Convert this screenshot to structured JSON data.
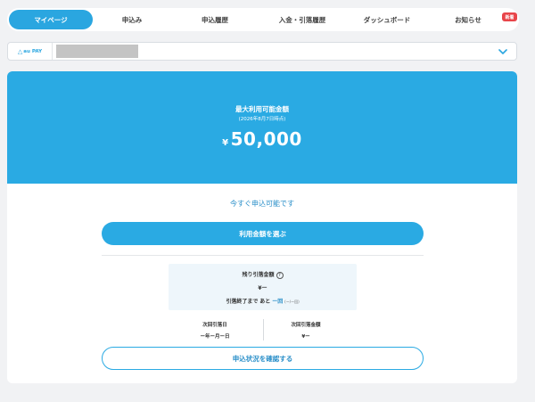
{
  "nav": {
    "items": [
      {
        "label": "マイページ",
        "active": true
      },
      {
        "label": "申込み"
      },
      {
        "label": "申込履歴"
      },
      {
        "label": "入金・引落履歴"
      },
      {
        "label": "ダッシュボード"
      },
      {
        "label": "お知らせ"
      }
    ],
    "badge": "新着"
  },
  "account": {
    "brand": "au PAY",
    "icon": "triangle-logo-icon"
  },
  "hero": {
    "title": "最大利用可能金額",
    "date": "(2026年8月7日時点)",
    "currency": "¥",
    "amount": "50,000"
  },
  "main": {
    "available_text": "今すぐ申込可能です",
    "primary_button": "利用金額を選ぶ",
    "remaining": {
      "label": "残り引落金額",
      "help": "?",
      "value": "¥ー",
      "until_prefix": "引落終了まで",
      "until_mid": "あと",
      "count": "ー回",
      "count_sub": "(ー/ー回)"
    },
    "next_date": {
      "label": "次回引落日",
      "value": "ー年ー月ー日"
    },
    "next_amount": {
      "label": "次回引落金額",
      "value": "¥ー"
    },
    "outline_button": "申込状況を確認する"
  },
  "colors": {
    "accent": "#2aaae3",
    "badge": "#e8454a"
  }
}
